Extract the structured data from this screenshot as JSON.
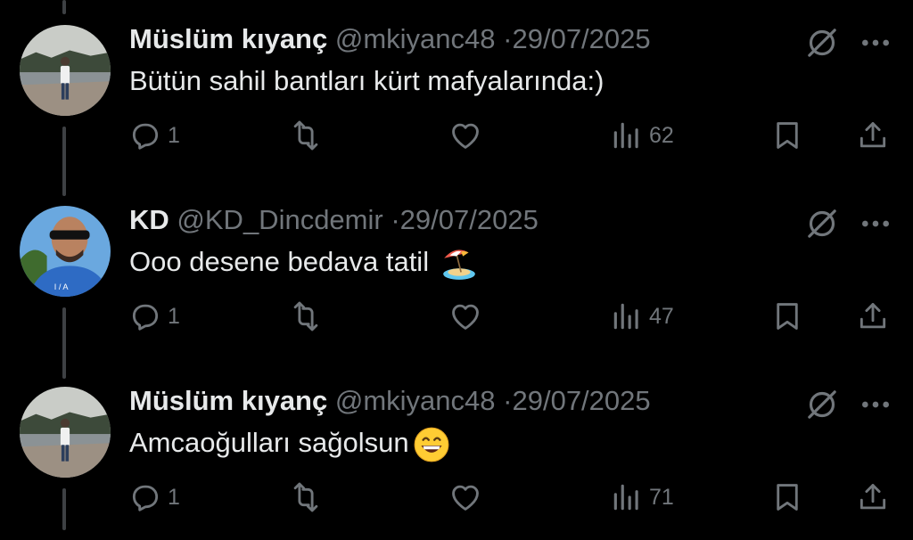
{
  "tweets": [
    {
      "name": "Müslüm kıyanç",
      "handle": "@mkiyanc48",
      "separator": "·",
      "date": "29/07/2025",
      "text": "Bütün sahil bantları kürt mafyalarında:)",
      "emoji": "",
      "replies": "1",
      "retweets": "",
      "likes": "",
      "views": "62",
      "avatar": "landscape-avatar"
    },
    {
      "name": "KD",
      "handle": "@KD_Dincdemir",
      "separator": "·",
      "date": "29/07/2025",
      "text": "Ooo desene bedava tatil",
      "emoji": "beach-umbrella-emoji",
      "replies": "1",
      "retweets": "",
      "likes": "",
      "views": "47",
      "avatar": "selfie-avatar"
    },
    {
      "name": "Müslüm kıyanç",
      "handle": "@mkiyanc48",
      "separator": "·",
      "date": "29/07/2025",
      "text": "Amcaoğulları sağolsun",
      "emoji": "grinning-face-emoji",
      "replies": "1",
      "retweets": "",
      "likes": "",
      "views": "71",
      "avatar": "landscape-avatar"
    }
  ],
  "colors": {
    "background": "#000000",
    "primary_text": "#e7e9ea",
    "secondary_text": "#71767b",
    "thread_line": "#3e4144"
  },
  "icons": [
    "grok-icon",
    "more-icon",
    "reply-icon",
    "retweet-icon",
    "like-icon",
    "views-icon",
    "bookmark-icon",
    "share-icon"
  ]
}
